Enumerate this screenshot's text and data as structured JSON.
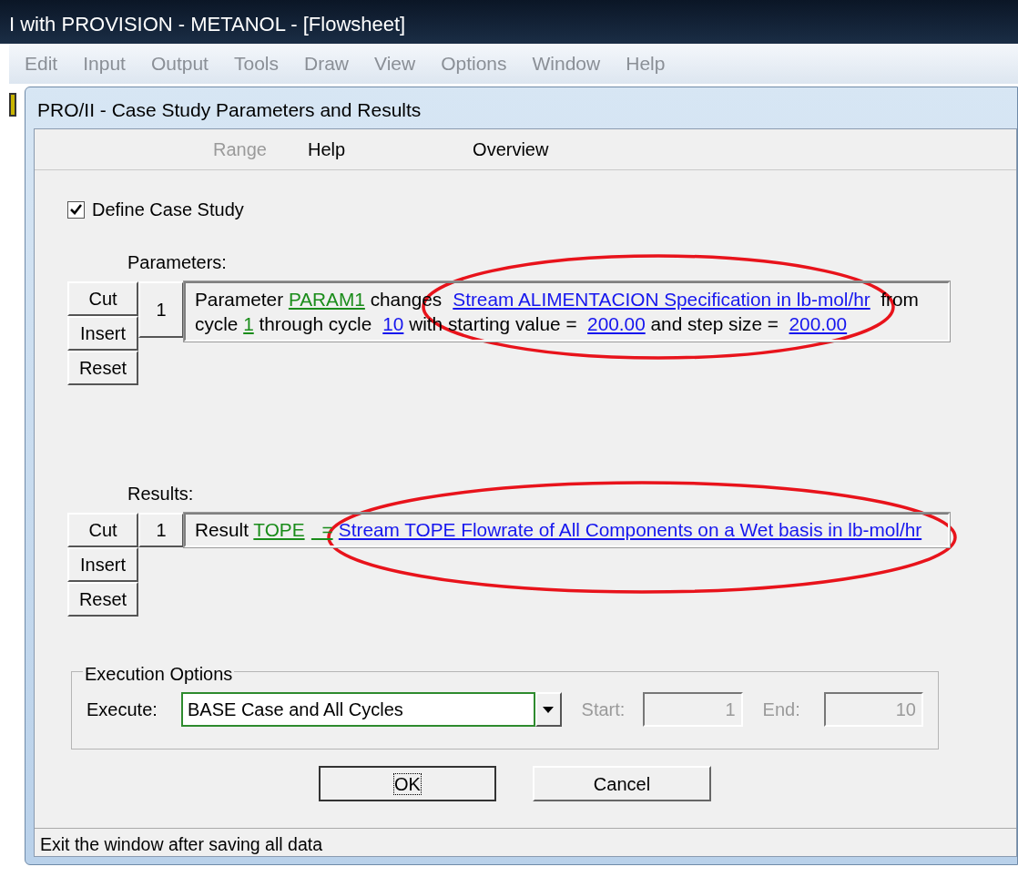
{
  "app_title": "I with PROVISION - METANOL - [Flowsheet]",
  "app_menu": [
    "Edit",
    "Input",
    "Output",
    "Tools",
    "Draw",
    "View",
    "Options",
    "Window",
    "Help"
  ],
  "dialog": {
    "title": "PRO/II - Case Study Parameters and Results",
    "menu": [
      {
        "label": "Range",
        "disabled": true
      },
      {
        "label": "Help",
        "disabled": false
      },
      {
        "label": "Overview",
        "disabled": false
      }
    ],
    "define_case_study": {
      "label": "Define Case Study",
      "checked": true
    },
    "parameters": {
      "label": "Parameters:",
      "buttons": [
        "Cut",
        "Insert",
        "Reset"
      ],
      "rows": [
        {
          "index": "1",
          "lines": [
            [
              {
                "kind": "text",
                "text": "Parameter "
              },
              {
                "kind": "name",
                "text": "PARAM1"
              },
              {
                "kind": "text",
                "text": " changes "
              },
              {
                "kind": "link",
                "text": "Stream ALIMENTACION Specification  in lb-mol/hr"
              },
              {
                "kind": "text",
                "text": "  from"
              }
            ],
            [
              {
                "kind": "text",
                "text": "cycle "
              },
              {
                "kind": "name",
                "text": "1"
              },
              {
                "kind": "text",
                "text": " through cycle "
              },
              {
                "kind": "link",
                "text": "10"
              },
              {
                "kind": "text",
                "text": " with starting value =  "
              },
              {
                "kind": "link",
                "text": "200.00"
              },
              {
                "kind": "text",
                "text": " and step size =  "
              },
              {
                "kind": "link",
                "text": "200.00"
              }
            ]
          ]
        }
      ]
    },
    "results": {
      "label": "Results:",
      "buttons": [
        "Cut",
        "Insert",
        "Reset"
      ],
      "rows": [
        {
          "index": "1",
          "lines": [
            [
              {
                "kind": "text",
                "text": "Result "
              },
              {
                "kind": "name",
                "text": "TOPE"
              },
              {
                "kind": "name",
                "text": "  ="
              },
              {
                "kind": "link",
                "text": "Stream TOPE Flowrate of All Components on a Wet basis in lb-mol/hr"
              }
            ]
          ]
        }
      ]
    },
    "execution_options": {
      "legend": "Execution Options",
      "execute_label": "Execute:",
      "execute_value": "BASE Case and All Cycles",
      "start_label": "Start:",
      "start_value": "1",
      "end_label": "End:",
      "end_value": "10",
      "range_disabled": true
    },
    "buttons": [
      {
        "label": "OK",
        "focused": true
      },
      {
        "label": "Cancel",
        "focused": false
      }
    ],
    "status_bar": "Exit the window after saving all data"
  }
}
